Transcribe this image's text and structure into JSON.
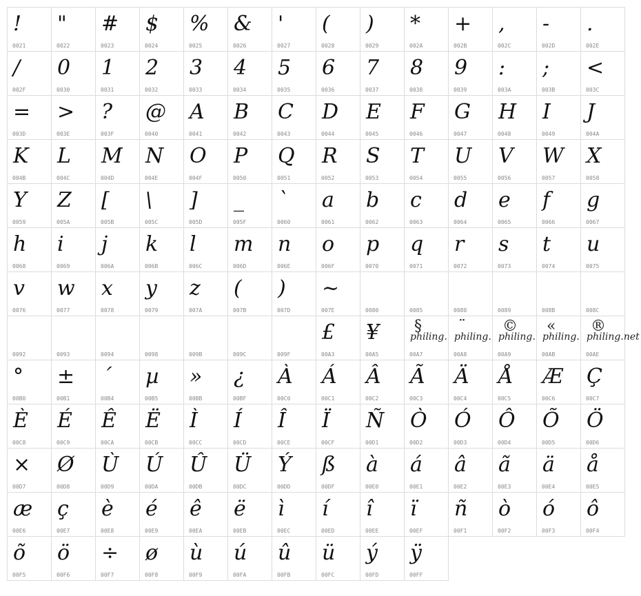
{
  "watermark_text": "philing.net",
  "rows": [
    [
      [
        "!",
        "0021"
      ],
      [
        "\"",
        "0022"
      ],
      [
        "#",
        "0023"
      ],
      [
        "$",
        "0024"
      ],
      [
        "%",
        "0025"
      ],
      [
        "&",
        "0026"
      ],
      [
        "'",
        "0027"
      ],
      [
        "(",
        "0028"
      ],
      [
        ")",
        "0029"
      ],
      [
        "*",
        "002A"
      ],
      [
        "+",
        "002B"
      ],
      [
        ",",
        "002C"
      ],
      [
        "-",
        "002D"
      ],
      [
        ".",
        "002E"
      ]
    ],
    [
      [
        "/",
        "002F"
      ],
      [
        "0",
        "0030"
      ],
      [
        "1",
        "0031"
      ],
      [
        "2",
        "0032"
      ],
      [
        "3",
        "0033"
      ],
      [
        "4",
        "0034"
      ],
      [
        "5",
        "0035"
      ],
      [
        "6",
        "0036"
      ],
      [
        "7",
        "0037"
      ],
      [
        "8",
        "0038"
      ],
      [
        "9",
        "0039"
      ],
      [
        ":",
        "003A"
      ],
      [
        ";",
        "003B"
      ],
      [
        "<",
        "003C"
      ]
    ],
    [
      [
        "=",
        "003D"
      ],
      [
        ">",
        "003E"
      ],
      [
        "?",
        "003F"
      ],
      [
        "@",
        "0040"
      ],
      [
        "A",
        "0041"
      ],
      [
        "B",
        "0042"
      ],
      [
        "C",
        "0043"
      ],
      [
        "D",
        "0044"
      ],
      [
        "E",
        "0045"
      ],
      [
        "F",
        "0046"
      ],
      [
        "G",
        "0047"
      ],
      [
        "H",
        "0048"
      ],
      [
        "I",
        "0049"
      ],
      [
        "J",
        "004A"
      ]
    ],
    [
      [
        "K",
        "004B"
      ],
      [
        "L",
        "004C"
      ],
      [
        "M",
        "004D"
      ],
      [
        "N",
        "004E"
      ],
      [
        "O",
        "004F"
      ],
      [
        "P",
        "0050"
      ],
      [
        "Q",
        "0051"
      ],
      [
        "R",
        "0052"
      ],
      [
        "S",
        "0053"
      ],
      [
        "T",
        "0054"
      ],
      [
        "U",
        "0055"
      ],
      [
        "V",
        "0056"
      ],
      [
        "W",
        "0057"
      ],
      [
        "X",
        "0058"
      ]
    ],
    [
      [
        "Y",
        "0059"
      ],
      [
        "Z",
        "005A"
      ],
      [
        "[",
        "005B"
      ],
      [
        "\\",
        "005C"
      ],
      [
        "]",
        "005D"
      ],
      [
        "_",
        "005F"
      ],
      [
        "`",
        "0060"
      ],
      [
        "a",
        "0061"
      ],
      [
        "b",
        "0062"
      ],
      [
        "c",
        "0063"
      ],
      [
        "d",
        "0064"
      ],
      [
        "e",
        "0065"
      ],
      [
        "f",
        "0066"
      ],
      [
        "g",
        "0067"
      ]
    ],
    [
      [
        "h",
        "0068"
      ],
      [
        "i",
        "0069"
      ],
      [
        "j",
        "006A"
      ],
      [
        "k",
        "006B"
      ],
      [
        "l",
        "006C"
      ],
      [
        "m",
        "006D"
      ],
      [
        "n",
        "006E"
      ],
      [
        "o",
        "006F"
      ],
      [
        "p",
        "0070"
      ],
      [
        "q",
        "0071"
      ],
      [
        "r",
        "0072"
      ],
      [
        "s",
        "0073"
      ],
      [
        "t",
        "0074"
      ],
      [
        "u",
        "0075"
      ]
    ],
    [
      [
        "v",
        "0076"
      ],
      [
        "w",
        "0077"
      ],
      [
        "x",
        "0078"
      ],
      [
        "y",
        "0079"
      ],
      [
        "z",
        "007A"
      ],
      [
        "(",
        "007B"
      ],
      [
        ")",
        "007D"
      ],
      [
        "~",
        "007E"
      ],
      [
        "",
        "0080"
      ],
      [
        "",
        "0085"
      ],
      [
        "",
        "0088"
      ],
      [
        "",
        "0089"
      ],
      [
        "",
        "008B"
      ],
      [
        "",
        "008C"
      ]
    ],
    [
      [
        "",
        "0092"
      ],
      [
        "",
        "0093"
      ],
      [
        "",
        "0094"
      ],
      [
        "",
        "0098"
      ],
      [
        "",
        "009B"
      ],
      [
        "",
        "009C"
      ],
      [
        "",
        "009F"
      ],
      [
        "£",
        "00A3"
      ],
      [
        "¥",
        "00A5"
      ],
      [
        "§",
        "00A7",
        "logo"
      ],
      [
        "¨",
        "00A8",
        "logo"
      ],
      [
        "©",
        "00A9",
        "logo"
      ],
      [
        "«",
        "00AB",
        "logo"
      ],
      [
        "®",
        "00AE",
        "logo"
      ]
    ],
    [
      [
        "°",
        "00B0"
      ],
      [
        "±",
        "00B1"
      ],
      [
        "´",
        "00B4"
      ],
      [
        "µ",
        "00B5"
      ],
      [
        "»",
        "00BB"
      ],
      [
        "¿",
        "00BF"
      ],
      [
        "À",
        "00C0"
      ],
      [
        "Á",
        "00C1"
      ],
      [
        "Â",
        "00C2"
      ],
      [
        "Ã",
        "00C3"
      ],
      [
        "Ä",
        "00C4"
      ],
      [
        "Å",
        "00C5"
      ],
      [
        "Æ",
        "00C6"
      ],
      [
        "Ç",
        "00C7"
      ]
    ],
    [
      [
        "È",
        "00C8"
      ],
      [
        "É",
        "00C9"
      ],
      [
        "Ê",
        "00CA"
      ],
      [
        "Ë",
        "00CB"
      ],
      [
        "Ì",
        "00CC"
      ],
      [
        "Í",
        "00CD"
      ],
      [
        "Î",
        "00CE"
      ],
      [
        "Ï",
        "00CF"
      ],
      [
        "Ñ",
        "00D1"
      ],
      [
        "Ò",
        "00D2"
      ],
      [
        "Ó",
        "00D3"
      ],
      [
        "Ô",
        "00D4"
      ],
      [
        "Õ",
        "00D5"
      ],
      [
        "Ö",
        "00D6"
      ]
    ],
    [
      [
        "×",
        "00D7"
      ],
      [
        "Ø",
        "00D8"
      ],
      [
        "Ù",
        "00D9"
      ],
      [
        "Ú",
        "00DA"
      ],
      [
        "Û",
        "00DB"
      ],
      [
        "Ü",
        "00DC"
      ],
      [
        "Ý",
        "00DD"
      ],
      [
        "ß",
        "00DF"
      ],
      [
        "à",
        "00E0"
      ],
      [
        "á",
        "00E1"
      ],
      [
        "â",
        "00E2"
      ],
      [
        "ã",
        "00E3"
      ],
      [
        "ä",
        "00E4"
      ],
      [
        "å",
        "00E5"
      ]
    ],
    [
      [
        "æ",
        "00E6"
      ],
      [
        "ç",
        "00E7"
      ],
      [
        "è",
        "00E8"
      ],
      [
        "é",
        "00E9"
      ],
      [
        "ê",
        "00EA"
      ],
      [
        "ë",
        "00EB"
      ],
      [
        "ì",
        "00EC"
      ],
      [
        "í",
        "00ED"
      ],
      [
        "î",
        "00EE"
      ],
      [
        "ï",
        "00EF"
      ],
      [
        "ñ",
        "00F1"
      ],
      [
        "ò",
        "00F2"
      ],
      [
        "ó",
        "00F3"
      ],
      [
        "ô",
        "00F4"
      ]
    ],
    [
      [
        "õ",
        "00F5"
      ],
      [
        "ö",
        "00F6"
      ],
      [
        "÷",
        "00F7"
      ],
      [
        "ø",
        "00F8"
      ],
      [
        "ù",
        "00F9"
      ],
      [
        "ú",
        "00FA"
      ],
      [
        "û",
        "00FB"
      ],
      [
        "ü",
        "00FC"
      ],
      [
        "ý",
        "00FD"
      ],
      [
        "ÿ",
        "00FF"
      ]
    ]
  ]
}
